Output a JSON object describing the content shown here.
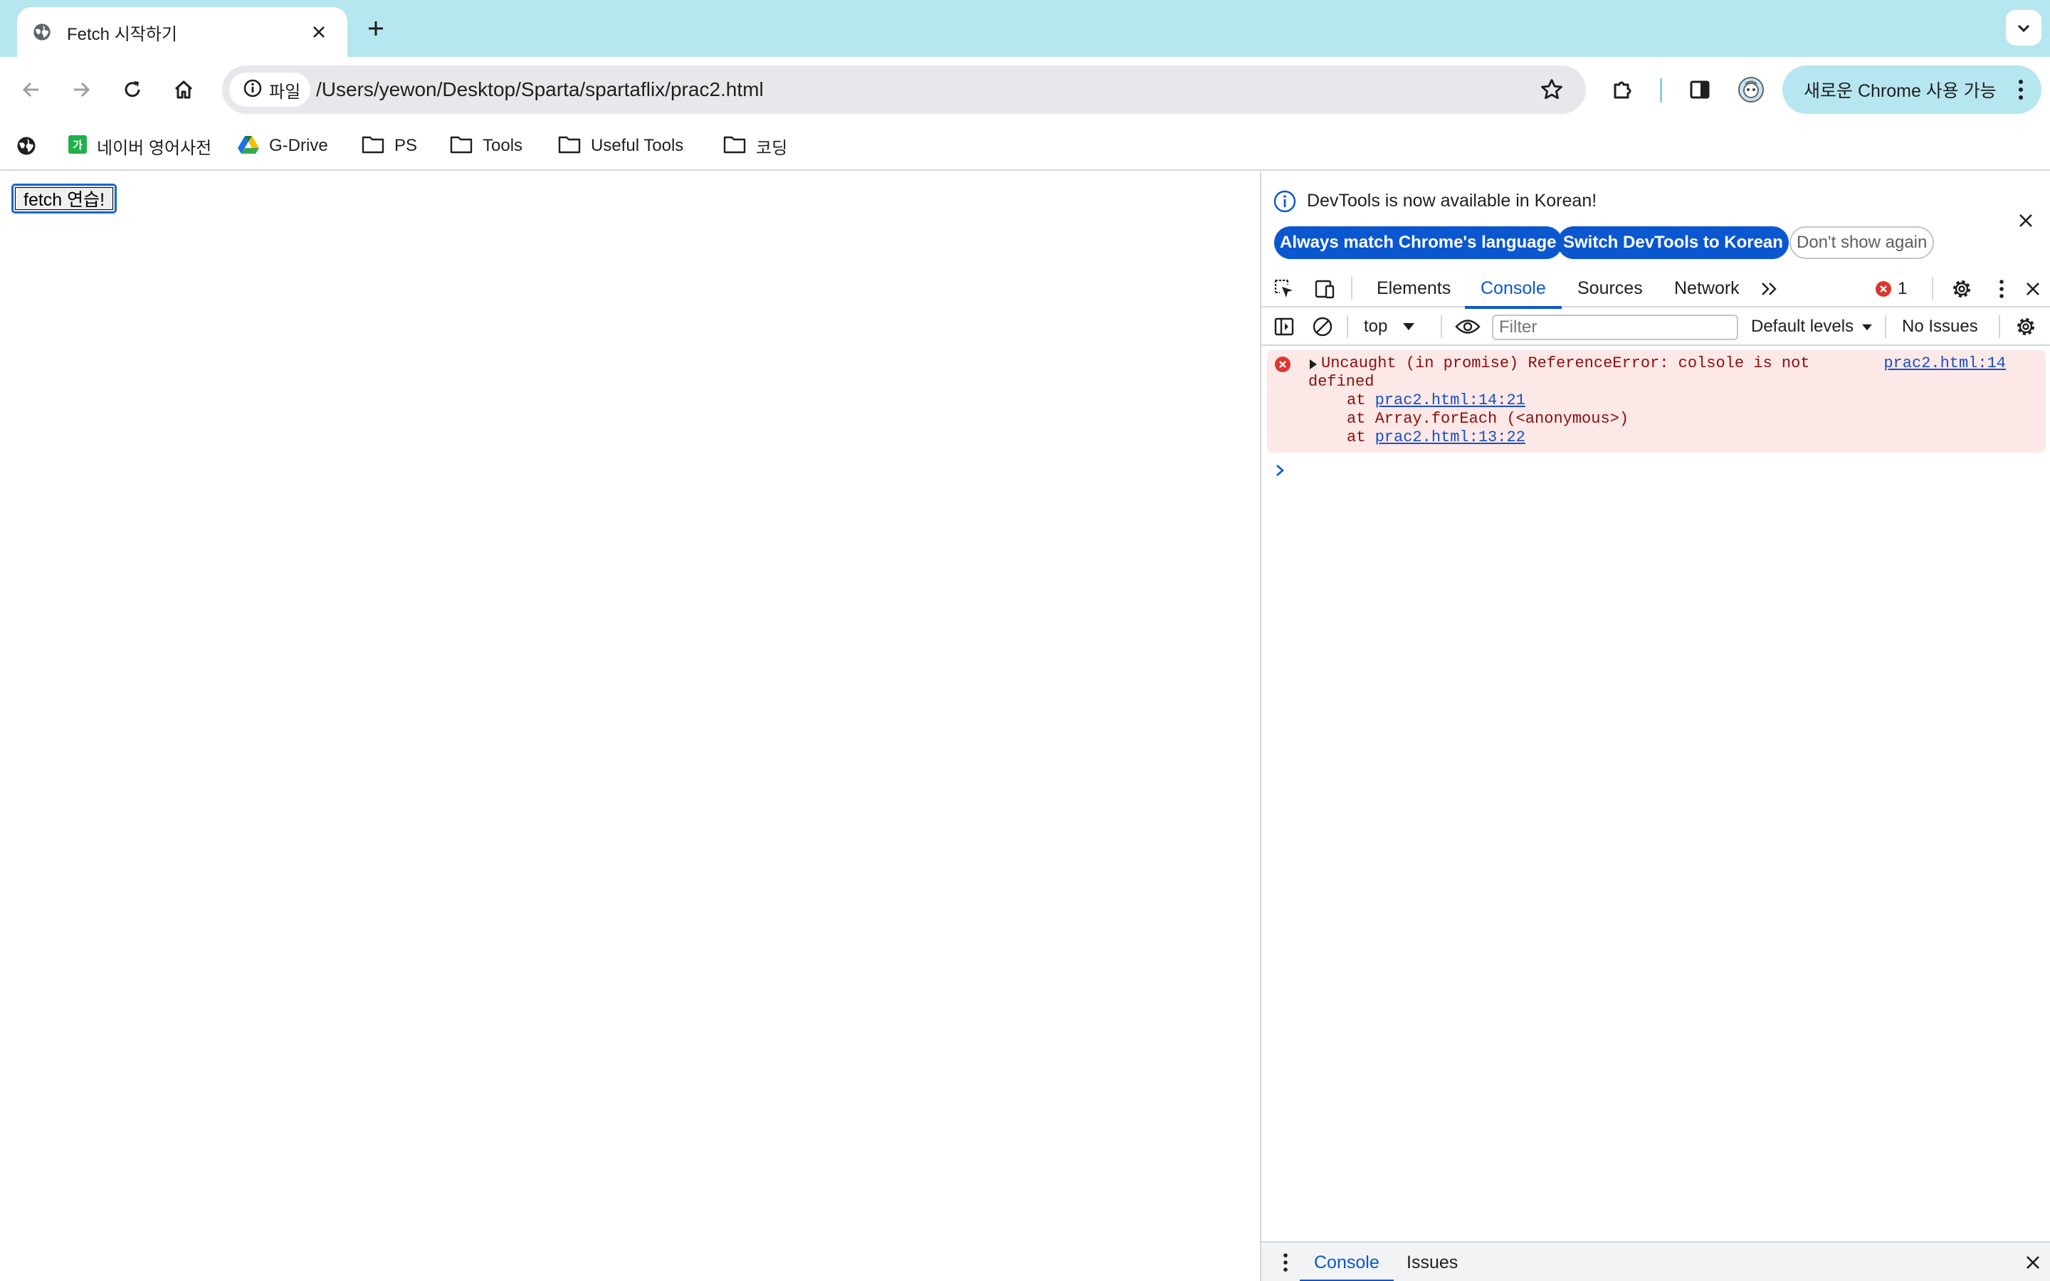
{
  "browser": {
    "tab": {
      "title": "Fetch 시작하기",
      "favicon": "globe-icon"
    },
    "address": {
      "chip_label": "파일",
      "url": "/Users/yewon/Desktop/Sparta/spartaflix/prac2.html"
    },
    "update_button": {
      "label": "새로운 Chrome 사용 가능"
    },
    "bookmarks": [
      {
        "label": "네이버 영어사전",
        "icon": "naver-dict-icon"
      },
      {
        "label": "G-Drive",
        "icon": "google-drive-icon"
      },
      {
        "label": "PS",
        "icon": "folder-icon"
      },
      {
        "label": "Tools",
        "icon": "folder-icon"
      },
      {
        "label": "Useful Tools",
        "icon": "folder-icon"
      },
      {
        "label": "코딩",
        "icon": "folder-icon"
      }
    ],
    "colors": {
      "frame": "#b6e6f0",
      "accent": "#0b57d0"
    }
  },
  "page": {
    "button_label": "fetch 연습!"
  },
  "devtools": {
    "infobar": {
      "message": "DevTools is now available in Korean!",
      "match_language": "Always match Chrome's language",
      "switch_korean": "Switch DevTools to Korean",
      "dont_show": "Don't show again"
    },
    "tabs": [
      "Elements",
      "Console",
      "Sources",
      "Network"
    ],
    "active_tab": "Console",
    "error_count": "1",
    "console_toolbar": {
      "context": "top",
      "filter_placeholder": "Filter",
      "levels": "Default levels",
      "issues": "No Issues"
    },
    "error": {
      "message_line1": "Uncaught (in promise) ReferenceError: colsole is not",
      "message_line2": "defined",
      "source": "prac2.html:14",
      "stack": [
        {
          "prefix": "at ",
          "link": "prac2.html:14:21",
          "text": ""
        },
        {
          "prefix": "at ",
          "link": "",
          "text": "Array.forEach (<anonymous>)"
        },
        {
          "prefix": "at ",
          "link": "prac2.html:13:22",
          "text": ""
        }
      ]
    },
    "drawer": {
      "tabs": [
        "Console",
        "Issues"
      ]
    }
  }
}
